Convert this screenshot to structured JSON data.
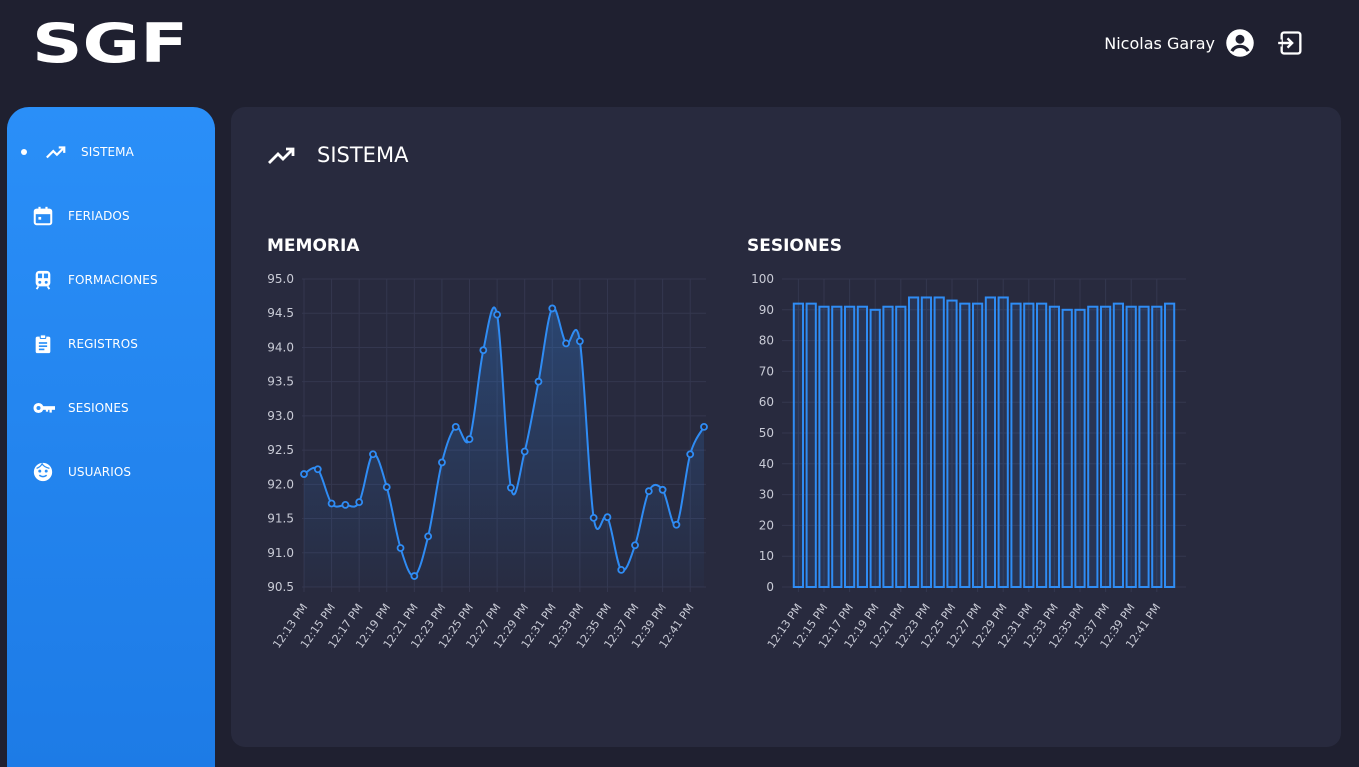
{
  "app": {
    "logo_text": "SGF"
  },
  "header": {
    "user_name": "Nicolas Garay"
  },
  "sidebar": {
    "items": [
      {
        "label": "SISTEMA",
        "icon": "trending-up-icon",
        "active": true
      },
      {
        "label": "FERIADOS",
        "icon": "calendar-icon"
      },
      {
        "label": "FORMACIONES",
        "icon": "train-icon"
      },
      {
        "label": "REGISTROS",
        "icon": "clipboard-icon"
      },
      {
        "label": "SESIONES",
        "icon": "key-icon"
      },
      {
        "label": "USUARIOS",
        "icon": "face-icon"
      }
    ]
  },
  "main": {
    "title": "SISTEMA",
    "title_icon": "trending-up-icon"
  },
  "colors": {
    "accent": "#2a8ff8",
    "panel": "#282a3e",
    "background": "#1f2030",
    "series": "#2f8cf4"
  },
  "chart_data": [
    {
      "type": "line",
      "title": "MEMORIA",
      "x": [
        "12:13 PM",
        "12:14 PM",
        "12:15 PM",
        "12:16 PM",
        "12:17 PM",
        "12:18 PM",
        "12:19 PM",
        "12:20 PM",
        "12:21 PM",
        "12:22 PM",
        "12:23 PM",
        "12:24 PM",
        "12:25 PM",
        "12:26 PM",
        "12:27 PM",
        "12:28 PM",
        "12:29 PM",
        "12:30 PM",
        "12:31 PM",
        "12:32 PM",
        "12:33 PM",
        "12:34 PM",
        "12:35 PM",
        "12:36 PM",
        "12:37 PM",
        "12:38 PM",
        "12:39 PM",
        "12:40 PM",
        "12:41 PM",
        "12:42 PM"
      ],
      "tick_labels": [
        "12:13 PM",
        "12:15 PM",
        "12:17 PM",
        "12:19 PM",
        "12:21 PM",
        "12:23 PM",
        "12:25 PM",
        "12:27 PM",
        "12:29 PM",
        "12:31 PM",
        "12:33 PM",
        "12:35 PM",
        "12:37 PM",
        "12:39 PM",
        "12:41 PM"
      ],
      "values": [
        92.15,
        92.22,
        91.72,
        91.7,
        91.74,
        92.44,
        91.96,
        91.07,
        90.66,
        91.24,
        92.32,
        92.84,
        92.66,
        93.96,
        94.48,
        91.95,
        92.48,
        93.5,
        94.57,
        94.06,
        94.09,
        91.51,
        91.52,
        90.75,
        91.11,
        91.9,
        91.92,
        91.41,
        92.44,
        92.84
      ],
      "ylim": [
        90.5,
        95.0
      ],
      "yticks": [
        "95.0",
        "94.5",
        "94.0",
        "93.5",
        "93.0",
        "92.5",
        "92.0",
        "91.5",
        "91.0",
        "90.5"
      ],
      "grid": true
    },
    {
      "type": "bar",
      "title": "SESIONES",
      "x": [
        "12:13 PM",
        "12:14 PM",
        "12:15 PM",
        "12:16 PM",
        "12:17 PM",
        "12:18 PM",
        "12:19 PM",
        "12:20 PM",
        "12:21 PM",
        "12:22 PM",
        "12:23 PM",
        "12:24 PM",
        "12:25 PM",
        "12:26 PM",
        "12:27 PM",
        "12:28 PM",
        "12:29 PM",
        "12:30 PM",
        "12:31 PM",
        "12:32 PM",
        "12:33 PM",
        "12:34 PM",
        "12:35 PM",
        "12:36 PM",
        "12:37 PM",
        "12:38 PM",
        "12:39 PM",
        "12:40 PM",
        "12:41 PM",
        "12:42 PM"
      ],
      "tick_labels": [
        "12:13 PM",
        "12:15 PM",
        "12:17 PM",
        "12:19 PM",
        "12:21 PM",
        "12:23 PM",
        "12:25 PM",
        "12:27 PM",
        "12:29 PM",
        "12:31 PM",
        "12:33 PM",
        "12:35 PM",
        "12:37 PM",
        "12:39 PM",
        "12:41 PM"
      ],
      "values": [
        92,
        92,
        91,
        91,
        91,
        91,
        90,
        91,
        91,
        94,
        94,
        94,
        93,
        92,
        92,
        94,
        94,
        92,
        92,
        92,
        91,
        90,
        90,
        91,
        91,
        92,
        91,
        91,
        91,
        92
      ],
      "ylim": [
        0,
        100
      ],
      "yticks": [
        "100",
        "90",
        "80",
        "70",
        "60",
        "50",
        "40",
        "30",
        "20",
        "10",
        "0"
      ],
      "grid": true
    }
  ]
}
